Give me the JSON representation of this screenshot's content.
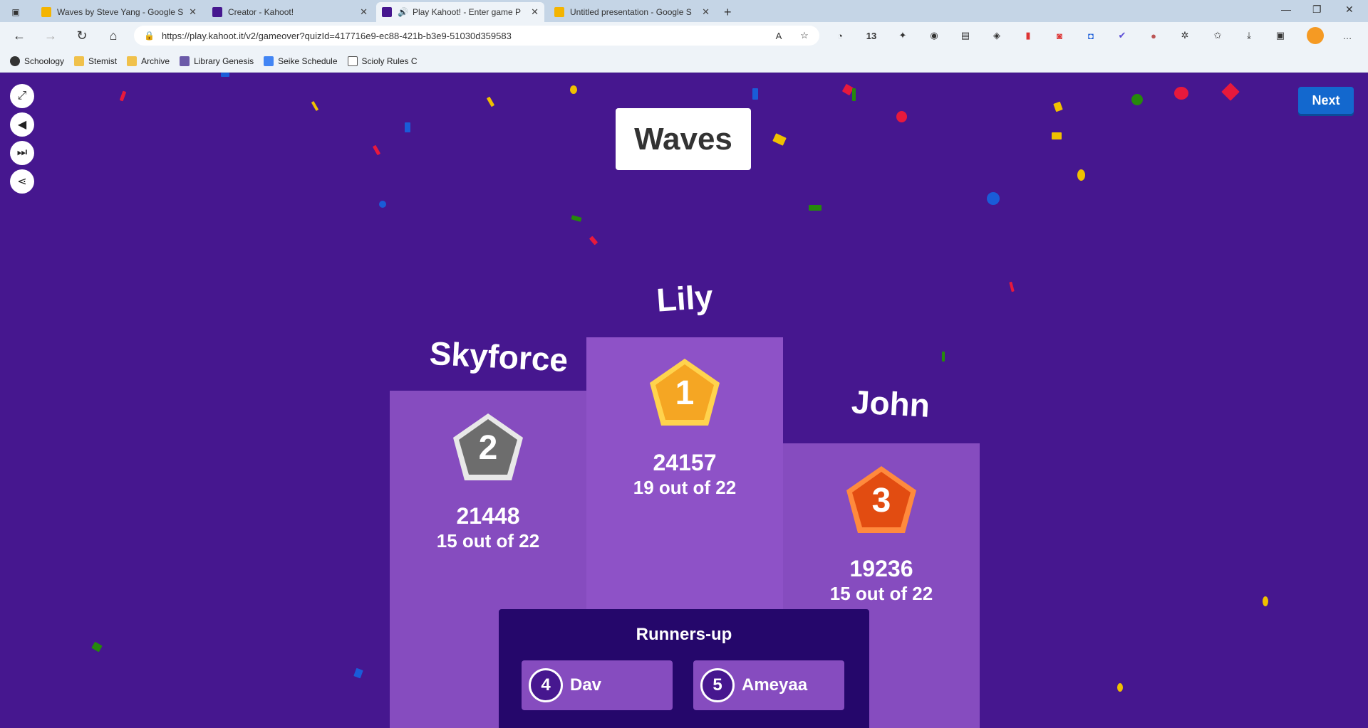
{
  "browser": {
    "tabs": [
      {
        "title": "Waves by Steve Yang - Google S",
        "icon_color": "#f4b400"
      },
      {
        "title": "Creator - Kahoot!",
        "icon_color": "#46178f"
      },
      {
        "title": "Play Kahoot! - Enter game P",
        "icon_color": "#46178f"
      },
      {
        "title": "Untitled presentation - Google S",
        "icon_color": "#f4b400"
      }
    ],
    "new_tab_label": "+",
    "url": "https://play.kahoot.it/v2/gameover?quizId=417716e9-ec88-421b-b3e9-51030d359583",
    "extension_badge": "13",
    "bookmarks": [
      "Schoology",
      "Stemist",
      "Archive",
      "Library Genesis",
      "Seike Schedule",
      "Scioly Rules C"
    ]
  },
  "game": {
    "quiz_title": "Waves",
    "next_label": "Next",
    "podium": {
      "first": {
        "rank": "1",
        "name": "Lily",
        "score": "24157",
        "correct": "19 out of 22",
        "medal_color": "#f5a623"
      },
      "second": {
        "rank": "2",
        "name": "Skyforce",
        "score": "21448",
        "correct": "15 out of 22",
        "medal_color": "#7a7a7a"
      },
      "third": {
        "rank": "3",
        "name": "John",
        "score": "19236",
        "correct": "15 out of 22",
        "medal_color": "#e24c11"
      }
    },
    "runners_up": {
      "title": "Runners-up",
      "players": [
        {
          "rank": "4",
          "name": "Dav"
        },
        {
          "rank": "5",
          "name": "Ameyaa"
        }
      ]
    }
  },
  "colors": {
    "background": "#46178f",
    "podium": "#864cbf",
    "runners_panel": "#25076b",
    "next_button": "#1368ce"
  }
}
